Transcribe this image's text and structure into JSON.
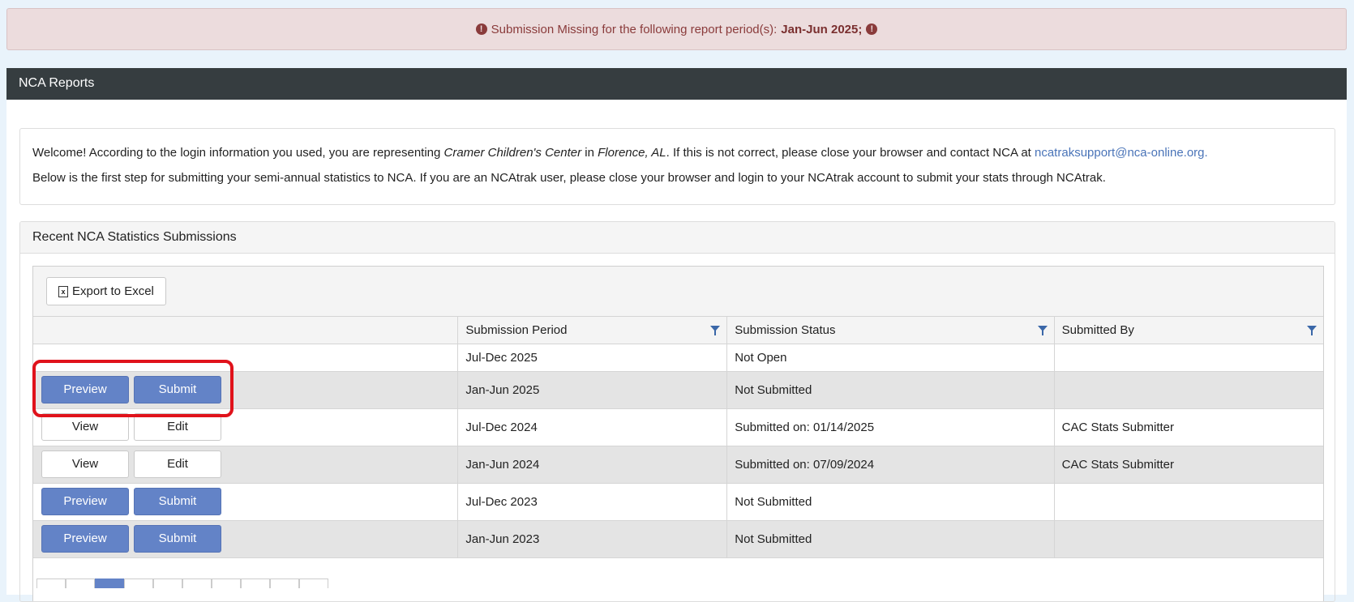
{
  "alert": {
    "text": "Submission Missing for the following report period(s):",
    "periods": "Jan-Jun 2025;",
    "icon": "exclamation-circle-icon"
  },
  "panel": {
    "title": "NCA Reports"
  },
  "welcome": {
    "line1_a": "Welcome! According to the login information you used, you are representing ",
    "center": "Cramer Children's Center",
    "line1_b": " in ",
    "location": "Florence, AL",
    "line1_c": ". If this is not correct, please close your browser and contact NCA at ",
    "email": "ncatraksupport@nca-online.org.",
    "line2": "Below is the first step for submitting your semi-annual statistics to NCA. If you are an NCAtrak user, please close your browser and login to your NCAtrak account to submit your stats through NCAtrak."
  },
  "recent": {
    "title": "Recent NCA Statistics Submissions",
    "export_label": "Export to Excel",
    "columns": [
      "Submission Period",
      "Submission Status",
      "Submitted By"
    ],
    "rows": [
      {
        "actions": [],
        "period": "Jul-Dec 2025",
        "status": "Not Open",
        "by": ""
      },
      {
        "actions": [
          "Preview",
          "Submit"
        ],
        "period": "Jan-Jun 2025",
        "status": "Not Submitted",
        "by": ""
      },
      {
        "actions": [
          "View",
          "Edit"
        ],
        "period": "Jul-Dec 2024",
        "status": "Submitted on: 01/14/2025",
        "by": "CAC Stats Submitter"
      },
      {
        "actions": [
          "View",
          "Edit"
        ],
        "period": "Jan-Jun 2024",
        "status": "Submitted on: 07/09/2024",
        "by": "CAC Stats Submitter"
      },
      {
        "actions": [
          "Preview",
          "Submit"
        ],
        "period": "Jul-Dec 2023",
        "status": "Not Submitted",
        "by": ""
      },
      {
        "actions": [
          "Preview",
          "Submit"
        ],
        "period": "Jan-Jun 2023",
        "status": "Not Submitted",
        "by": ""
      }
    ]
  },
  "colors": {
    "primary_button": "#6383c7",
    "header_bar": "#363d40",
    "alert_bg": "#ecdcdd",
    "highlight": "#e0121b"
  }
}
